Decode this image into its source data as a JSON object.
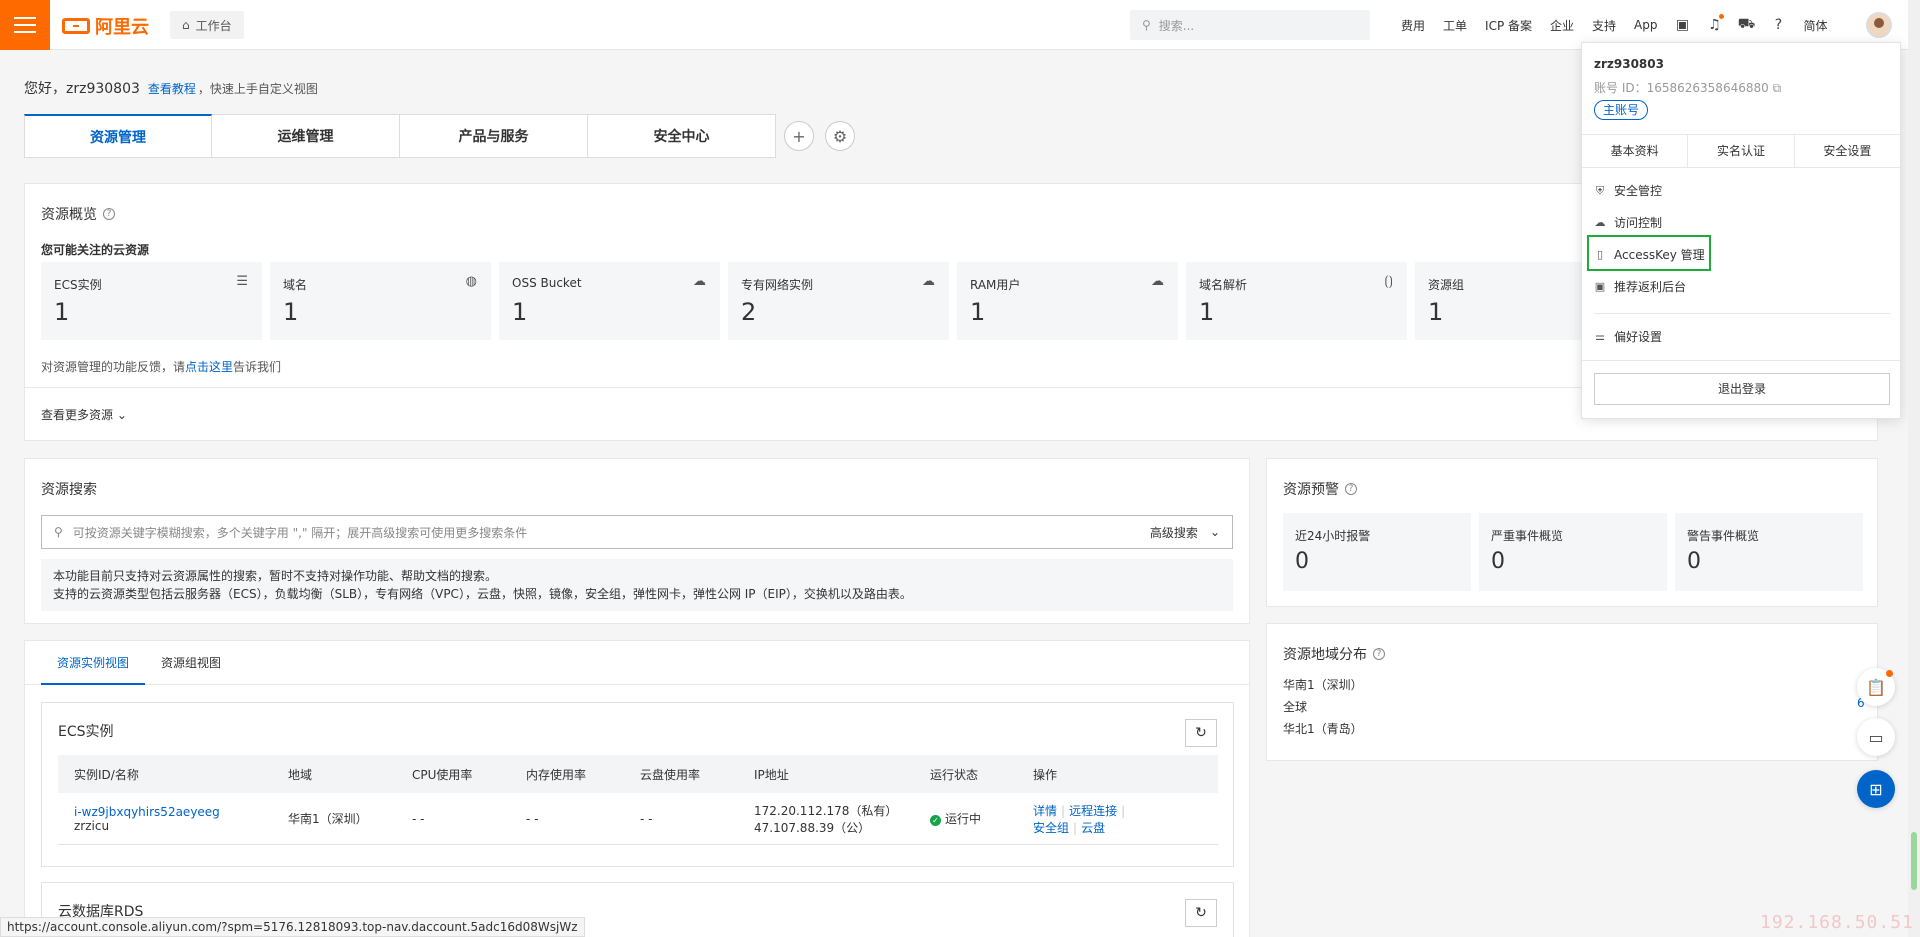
{
  "topnav": {
    "brand": "阿里云",
    "workbench": "工作台",
    "search_placeholder": "搜索...",
    "items": [
      "费用",
      "工单",
      "ICP 备案",
      "企业",
      "支持",
      "App"
    ],
    "lang": "简体",
    "icons": [
      "image-icon",
      "bell-icon",
      "cart-icon",
      "help-icon"
    ],
    "accent": "#ff6a00"
  },
  "greeting": {
    "hello": "您好，",
    "user": "zrz930803",
    "tutorial": "查看教程",
    "tip": "，快速上手自定义视图"
  },
  "tabs": [
    "资源管理",
    "运维管理",
    "产品与服务",
    "安全中心"
  ],
  "overview": {
    "title": "资源概览",
    "subtitle": "您可能关注的云资源",
    "tiles": [
      {
        "name": "ECS实例",
        "count": "1"
      },
      {
        "name": "域名",
        "count": "1"
      },
      {
        "name": "OSS Bucket",
        "count": "1"
      },
      {
        "name": "专有网络实例",
        "count": "2"
      },
      {
        "name": "RAM用户",
        "count": "1"
      },
      {
        "name": "域名解析",
        "count": "1"
      },
      {
        "name": "资源组",
        "count": "1"
      }
    ],
    "feedback_prefix": "对资源管理的功能反馈，请",
    "feedback_link": "点击这里",
    "feedback_suffix": "告诉我们",
    "more": "查看更多资源"
  },
  "search": {
    "title": "资源搜索",
    "placeholder": "可按资源关键字模糊搜索，多个关键字用 \",\" 隔开；展开高级搜索可使用更多搜索条件",
    "advanced": "高级搜索",
    "note1": "本功能目前只支持对云资源属性的搜索，暂时不支持对操作功能、帮助文档的搜索。",
    "note2": "支持的云资源类型包括云服务器（ECS），负载均衡（SLB），专有网络（VPC），云盘，快照，镜像，安全组，弹性网卡，弹性公网 IP（EIP），交换机以及路由表。"
  },
  "alerts": {
    "title": "资源预警",
    "tiles": [
      {
        "name": "近24小时报警",
        "count": "0"
      },
      {
        "name": "严重事件概览",
        "count": "0"
      },
      {
        "name": "警告事件概览",
        "count": "0"
      }
    ]
  },
  "regions": {
    "title": "资源地域分布",
    "items": [
      "华南1（深圳）",
      "全球",
      "华北1（青岛）"
    ],
    "global_count": "6"
  },
  "instances": {
    "tabs": [
      "资源实例视图",
      "资源组视图"
    ],
    "ecs_title": "ECS实例",
    "columns": [
      "实例ID/名称",
      "地域",
      "CPU使用率",
      "内存使用率",
      "云盘使用率",
      "IP地址",
      "运行状态",
      "操作"
    ],
    "rows": [
      {
        "id": "i-wz9jbxqyhirs52aeyeeg",
        "name": "zrzicu",
        "region": "华南1（深圳）",
        "cpu": "- -",
        "mem": "- -",
        "disk": "- -",
        "ip_private": "172.20.112.178（私有）",
        "ip_public": "47.107.88.39（公）",
        "status": "运行中",
        "ops": [
          "详情",
          "远程连接",
          "安全组",
          "云盘"
        ]
      }
    ],
    "rds_title": "云数据库RDS"
  },
  "account": {
    "username": "zrz930803",
    "uid": "账号 ID：1658626358646880",
    "badge": "主账号",
    "tabs": [
      "基本资料",
      "实名认证",
      "安全设置"
    ],
    "menu": [
      "安全管控",
      "访问控制",
      "AccessKey 管理",
      "推荐返利后台",
      "偏好设置"
    ],
    "logout": "退出登录"
  },
  "status_url": "https://account.console.aliyun.com/?spm=5176.12818093.top-nav.daccount.5adc16d08WsjWz",
  "watermark": "192.168.50.51"
}
